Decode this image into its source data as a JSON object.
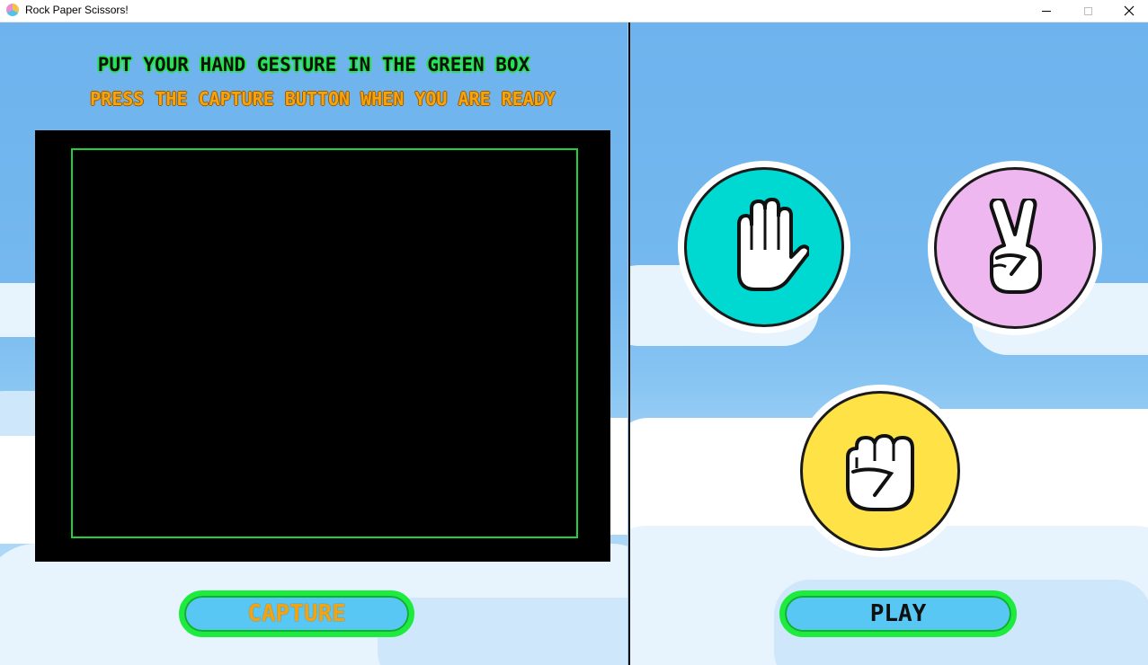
{
  "window": {
    "title": "Rock Paper Scissors!",
    "controls": {
      "minimize": "minimize",
      "maximize": "maximize",
      "close": "close"
    }
  },
  "left_panel": {
    "instruction_1": "PUT YOUR HAND GESTURE IN THE GREEN BOX",
    "instruction_2": "PRESS THE CAPTURE BUTTON WHEN YOU ARE READY",
    "capture_button": "CAPTURE"
  },
  "right_panel": {
    "gestures": [
      {
        "name": "paper",
        "icon": "open-hand-icon",
        "color": "#00d9d2"
      },
      {
        "name": "scissors",
        "icon": "peace-hand-icon",
        "color": "#efb7ef"
      },
      {
        "name": "rock",
        "icon": "fist-icon",
        "color": "#ffe346"
      }
    ],
    "play_button": "PLAY"
  },
  "colors": {
    "sky": "#6fb6ee",
    "button_border": "#1dec3e",
    "button_fill": "#59c7f4",
    "guide_box": "#22d03a",
    "orange_text": "#f5a30f"
  }
}
